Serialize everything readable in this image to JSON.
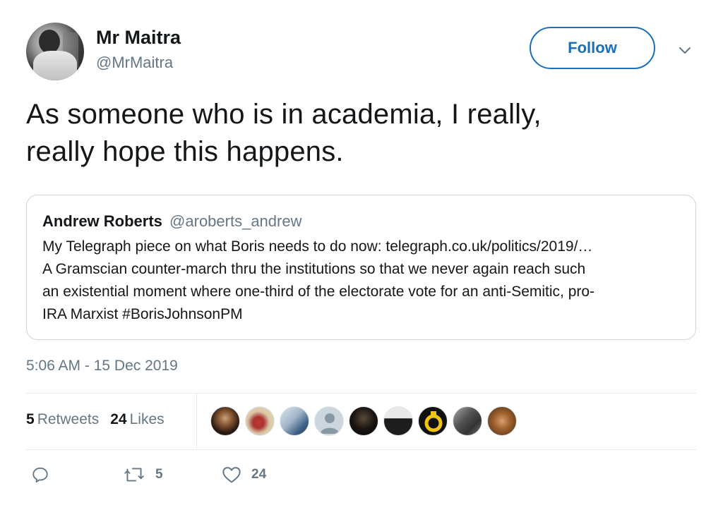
{
  "user": {
    "name": "Mr Maitra",
    "handle": "@MrMaitra"
  },
  "follow_label": "Follow",
  "tweet": {
    "line1": "As someone who is in academia, I really,",
    "line2": "really hope this happens."
  },
  "quote": {
    "author": "Andrew Roberts",
    "handle": "@aroberts_andrew",
    "lines": [
      "My Telegraph piece on what Boris needs to do now: telegraph.co.uk/politics/2019/…",
      "A Gramscian counter-march thru the institutions so that we never again reach such",
      "an existential moment where one-third of the electorate vote for an anti-Semitic, pro-",
      "IRA Marxist #BorisJohnsonPM"
    ]
  },
  "timestamp": "5:06 AM - 15 Dec 2019",
  "stats": {
    "retweets_count": "5",
    "retweets_label": "Retweets",
    "likes_count": "24",
    "likes_label": "Likes"
  },
  "actions": {
    "retweet_count": "5",
    "like_count": "24"
  },
  "liker_avatars": [
    "portrait",
    "cartoon",
    "illustration",
    "default",
    "dark",
    "man",
    "ring-logo",
    "figure",
    "painting"
  ],
  "colors": {
    "accent": "#1b6fb9",
    "secondary_text": "#657786",
    "border": "#ccd6dd"
  }
}
